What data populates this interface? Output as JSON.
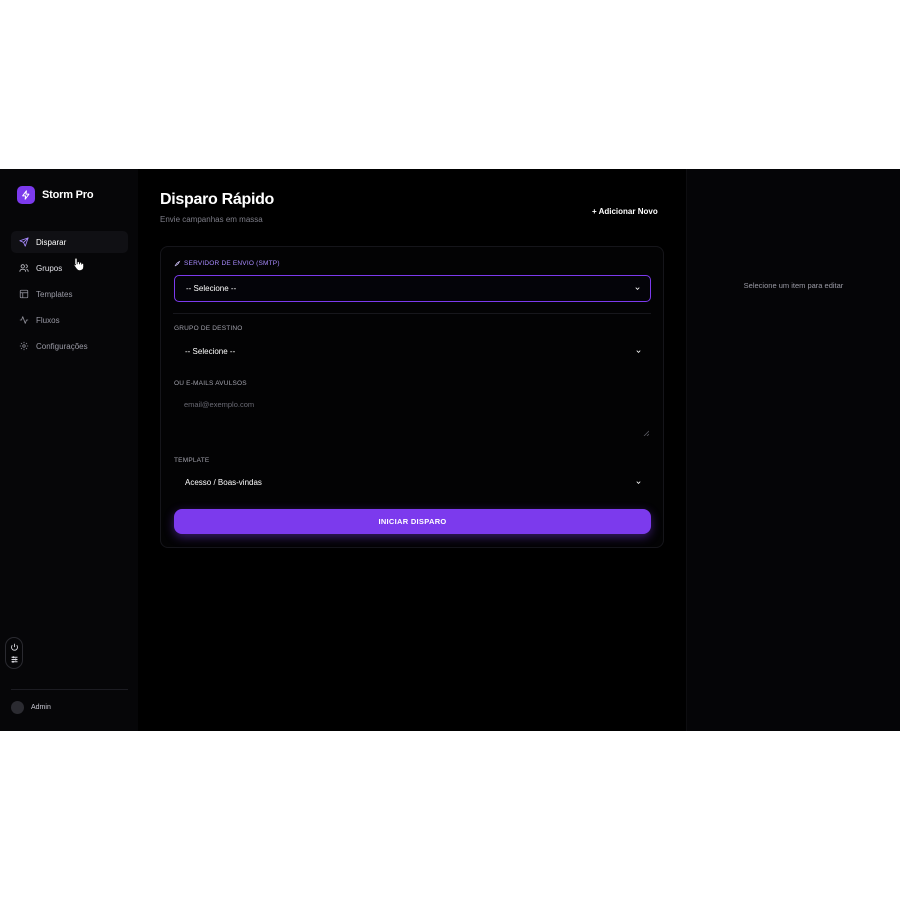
{
  "brand": {
    "name": "Storm Pro",
    "icon": "lightning-icon",
    "accent": "#7c3aed"
  },
  "sidebar": {
    "items": [
      {
        "label": "Disparar",
        "icon": "send-icon",
        "active": true
      },
      {
        "label": "Grupos",
        "icon": "users-icon",
        "active": false
      },
      {
        "label": "Templates",
        "icon": "layout-icon",
        "active": false
      },
      {
        "label": "Fluxos",
        "icon": "activity-icon",
        "active": false
      },
      {
        "label": "Configurações",
        "icon": "gear-icon",
        "active": false
      }
    ],
    "tools": [
      "power-icon",
      "sliders-icon"
    ]
  },
  "user": {
    "name": "Admin"
  },
  "main": {
    "title": "Disparo Rápido",
    "subtitle": "Envie campanhas em massa",
    "add_new_label": "+ Adicionar Novo",
    "form": {
      "smtp_label": "SERVIDOR DE ENVIO (SMTP)",
      "smtp_value": "-- Selecione --",
      "group_label": "GRUPO DE DESTINO",
      "group_value": "-- Selecione --",
      "emails_label": "OU E-MAILS AVULSOS",
      "emails_placeholder": "email@exemplo.com",
      "template_label": "TEMPLATE",
      "template_value": "Acesso / Boas-vindas",
      "submit_label": "INICIAR DISPARO"
    }
  },
  "right_panel": {
    "hint": "Selecione um item para editar"
  }
}
